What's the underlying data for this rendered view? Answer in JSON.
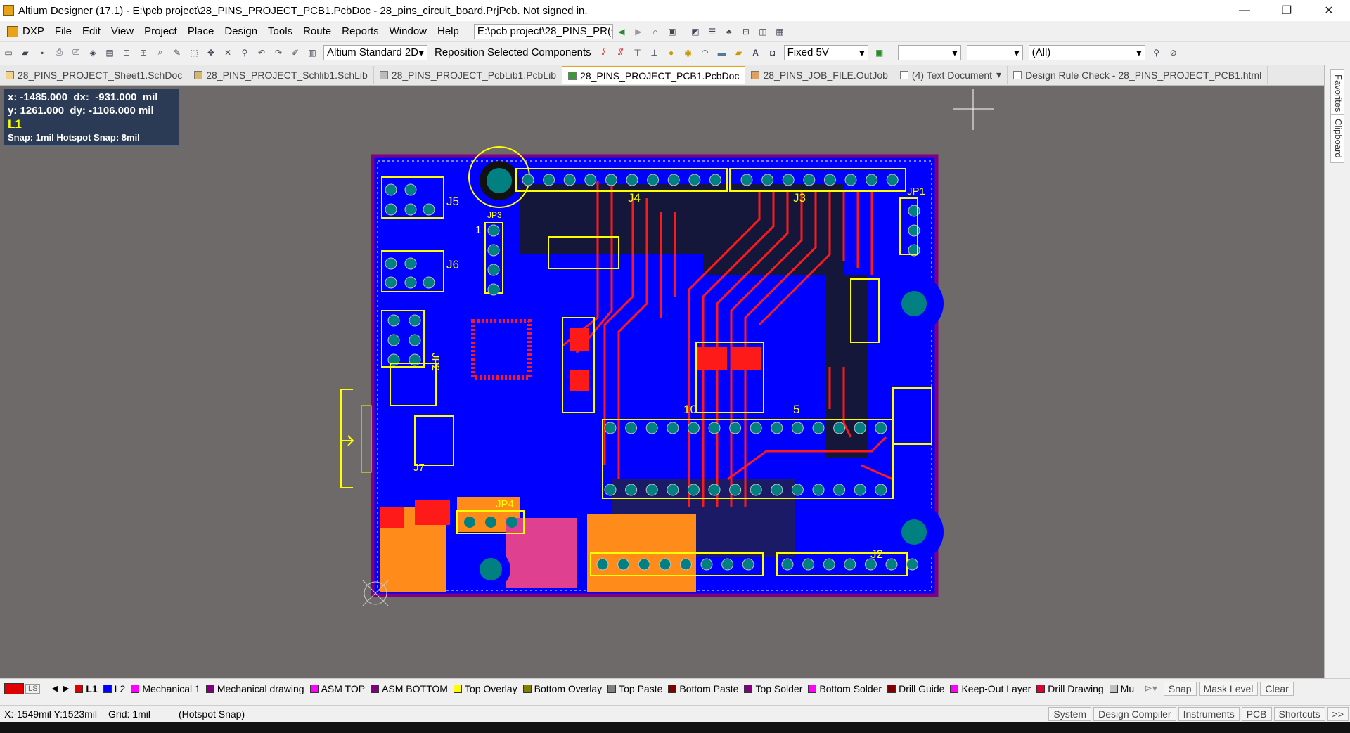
{
  "window": {
    "title": "Altium Designer (17.1) - E:\\pcb project\\28_PINS_PROJECT_PCB1.PcbDoc - 28_pins_circuit_board.PrjPcb. Not signed in.",
    "minimize": "—",
    "restore": "❐",
    "close": "✕"
  },
  "menu": {
    "dxp": "DXP",
    "items": [
      "File",
      "Edit",
      "View",
      "Project",
      "Place",
      "Design",
      "Tools",
      "Route",
      "Reports",
      "Window",
      "Help"
    ],
    "path": "E:\\pcb project\\28_PINS_PR("
  },
  "toolbar": {
    "view_mode": "Altium Standard 2D",
    "reposition": "Reposition Selected Components",
    "fixed": "Fixed 5V",
    "filter": "(All)"
  },
  "tabs": [
    {
      "label": "28_PINS_PROJECT_Sheet1.SchDoc",
      "active": false
    },
    {
      "label": "28_PINS_PROJECT_Schlib1.SchLib",
      "active": false
    },
    {
      "label": "28_PINS_PROJECT_PcbLib1.PcbLib",
      "active": false
    },
    {
      "label": "28_PINS_PROJECT_PCB1.PcbDoc",
      "active": true
    },
    {
      "label": "28_PINS_JOB_FILE.OutJob",
      "active": false
    },
    {
      "label": "(4) Text Document",
      "active": false
    },
    {
      "label": "Design Rule Check - 28_PINS_PROJECT_PCB1.html",
      "active": false
    }
  ],
  "side_panels": [
    "Favorites",
    "Clipboard"
  ],
  "coords": {
    "line1": "x: -1485.000  dx:  -931.000  mil",
    "line2": "y: 1261.000  dy: -1106.000 mil",
    "layer": "L1",
    "snap": "Snap: 1mil Hotspot Snap: 8mil"
  },
  "pcb_labels": {
    "J5": "J5",
    "J6": "J6",
    "J4": "J4",
    "J3": "J3",
    "JP1": "JP1",
    "JP2": "JP2",
    "JP3": "JP3",
    "JP4": "JP4",
    "J7": "J7",
    "J2": "J2",
    "n10": "10",
    "n5": "5",
    "n1": "1"
  },
  "layers": [
    {
      "name": "L1",
      "color": "#e00000",
      "active": true
    },
    {
      "name": "L2",
      "color": "#0000ff"
    },
    {
      "name": "Mechanical 1",
      "color": "#ff00ff"
    },
    {
      "name": "Mechanical drawing",
      "color": "#800080"
    },
    {
      "name": "ASM TOP",
      "color": "#ff00ff"
    },
    {
      "name": "ASM BOTTOM",
      "color": "#800080"
    },
    {
      "name": "Top Overlay",
      "color": "#ffff00"
    },
    {
      "name": "Bottom Overlay",
      "color": "#808000"
    },
    {
      "name": "Top Paste",
      "color": "#808080"
    },
    {
      "name": "Bottom Paste",
      "color": "#800000"
    },
    {
      "name": "Top Solder",
      "color": "#800080"
    },
    {
      "name": "Bottom Solder",
      "color": "#ff00ff"
    },
    {
      "name": "Drill Guide",
      "color": "#800000"
    },
    {
      "name": "Keep-Out Layer",
      "color": "#ff00ff"
    },
    {
      "name": "Drill Drawing",
      "color": "#e00030"
    },
    {
      "name": "Mu",
      "color": "#c0c0c0"
    }
  ],
  "layer_controls": {
    "ls": "LS",
    "snap": "Snap",
    "mask": "Mask Level",
    "clear": "Clear"
  },
  "status": {
    "coords": "X:-1549mil Y:1523mil",
    "grid": "Grid: 1mil",
    "hotspot": "(Hotspot Snap)",
    "buttons": [
      "System",
      "Design Compiler",
      "Instruments",
      "PCB",
      "Shortcuts",
      ">>"
    ]
  }
}
